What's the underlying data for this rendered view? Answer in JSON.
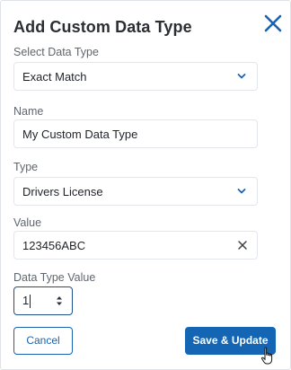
{
  "dialog": {
    "title": "Add Custom Data Type",
    "close_icon": "close-icon"
  },
  "fields": {
    "select_data_type": {
      "label": "Select Data Type",
      "value": "Exact Match",
      "icon": "chevron-down-icon"
    },
    "name": {
      "label": "Name",
      "value": "My Custom Data Type"
    },
    "type": {
      "label": "Type",
      "value": "Drivers License",
      "icon": "chevron-down-icon"
    },
    "value": {
      "label": "Value",
      "value": "123456ABC",
      "icon": "clear-icon"
    },
    "data_type_value": {
      "label": "Data Type Value",
      "value": "1",
      "icon": "spin-arrows-icon"
    }
  },
  "buttons": {
    "cancel": "Cancel",
    "save": "Save & Update"
  },
  "colors": {
    "accent": "#1565b5",
    "focus_border": "#1f4f8b"
  }
}
